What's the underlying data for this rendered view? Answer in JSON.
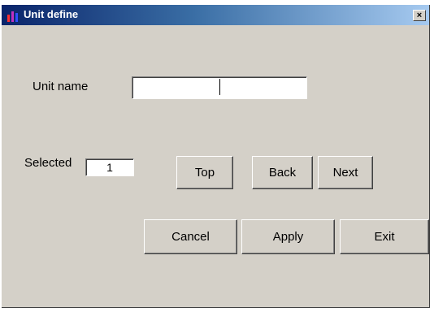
{
  "window": {
    "title": "Unit define",
    "close_symbol": "×",
    "icon": "bar-chart-icon"
  },
  "form": {
    "unit_name_label": "Unit name",
    "unit_name_value": "",
    "selected_label": "Selected",
    "selected_value": "1"
  },
  "buttons": {
    "top": "Top",
    "back": "Back",
    "next": "Next",
    "cancel": "Cancel",
    "apply": "Apply",
    "exit": "Exit"
  },
  "colors": {
    "titlebar_start": "#0a246a",
    "titlebar_end": "#a6caf0",
    "face": "#d4d0c8"
  }
}
